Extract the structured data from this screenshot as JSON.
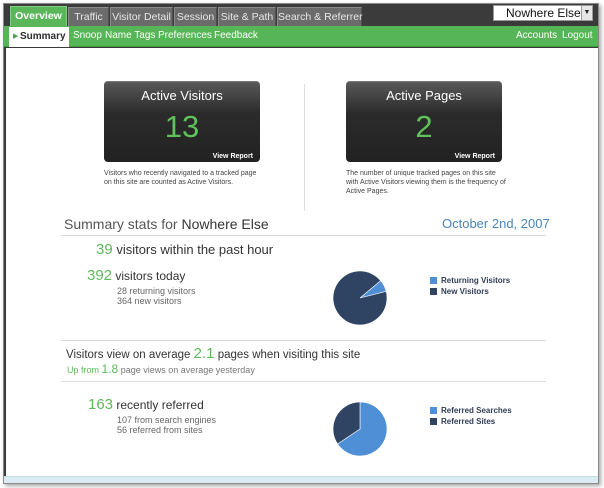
{
  "nav": {
    "tabs": [
      {
        "label": "Overview",
        "active": true
      },
      {
        "label": "Traffic"
      },
      {
        "label": "Visitor Detail"
      },
      {
        "label": "Session"
      },
      {
        "label": "Site & Path"
      },
      {
        "label": "Search & Referrer"
      }
    ],
    "site_selector": "Nowhere Else"
  },
  "subnav": {
    "items": [
      "Summary",
      "Snoop",
      "Name Tags",
      "Preferences",
      "Feedback"
    ],
    "right": [
      "Accounts",
      "Logout"
    ]
  },
  "cards": {
    "visitors": {
      "title": "Active Visitors",
      "value": "13",
      "link": "View Report",
      "desc": "Visitors who recently navigated to a tracked page on this site are counted as Active Visitors."
    },
    "pages": {
      "title": "Active Pages",
      "value": "2",
      "link": "View Report",
      "desc": "The number of unique tracked pages on this site with Active Visitors viewing them is the frequency of Active Pages."
    }
  },
  "summary": {
    "prefix": "Summary stats for",
    "site": "Nowhere Else",
    "date": "October 2nd, 2007"
  },
  "stats": {
    "hour_value": "39",
    "hour_label": "visitors within the past hour",
    "today_value": "392",
    "today_label": "visitors today",
    "returning": "28 returning visitors",
    "new": "364 new visitors",
    "avg_prefix": "Visitors view on average",
    "avg_value": "2.1",
    "avg_suffix": "pages when visiting this site",
    "up_prefix": "Up from",
    "up_value": "1.8",
    "up_suffix": "page views on average yesterday",
    "referred_value": "163",
    "referred_label": "recently referred",
    "search_engines": "107 from search engines",
    "sites": "56 referred from sites"
  },
  "colors": {
    "light_blue": "#4f8fd6",
    "dark_navy": "#2f4463",
    "green": "#5fb95b"
  },
  "chart_data": [
    {
      "type": "pie",
      "labels": [
        "Returning Visitors",
        "New Visitors"
      ],
      "values": [
        28,
        364
      ]
    },
    {
      "type": "pie",
      "labels": [
        "Referred Searches",
        "Referred Sites"
      ],
      "values": [
        107,
        56
      ]
    }
  ]
}
